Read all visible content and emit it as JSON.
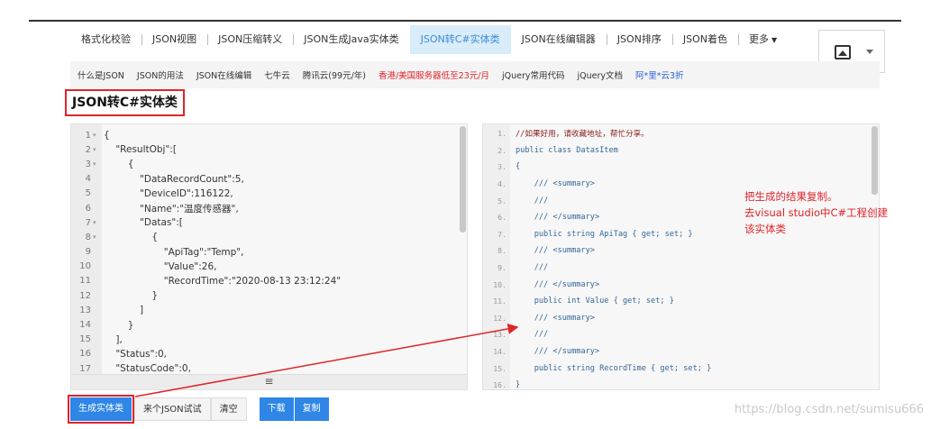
{
  "tabs": [
    {
      "label": "格式化校验"
    },
    {
      "label": "JSON视图"
    },
    {
      "label": "JSON压缩转义"
    },
    {
      "label": "JSON生成Java实体类"
    },
    {
      "label": "JSON转C#实体类",
      "active": true
    },
    {
      "label": "JSON在线编辑器"
    },
    {
      "label": "JSON排序"
    },
    {
      "label": "JSON着色"
    },
    {
      "label": "更多"
    }
  ],
  "links": [
    {
      "label": "什么是JSON",
      "color": "default"
    },
    {
      "label": "JSON的用法",
      "color": "default"
    },
    {
      "label": "JSON在线编辑",
      "color": "default"
    },
    {
      "label": "七牛云",
      "color": "default"
    },
    {
      "label": "腾讯云(99元/年)",
      "color": "default"
    },
    {
      "label": "香港/美国服务器低至23元/月",
      "color": "red"
    },
    {
      "label": "jQuery常用代码",
      "color": "default"
    },
    {
      "label": "jQuery文档",
      "color": "default"
    },
    {
      "label": "阿*里*云3折",
      "color": "blue"
    }
  ],
  "page_title": "JSON转C#实体类",
  "left_editor": {
    "lines": [
      {
        "n": "1",
        "fold": true,
        "code": "{"
      },
      {
        "n": "2",
        "fold": true,
        "code": "    \"ResultObj\":["
      },
      {
        "n": "3",
        "fold": true,
        "code": "        {"
      },
      {
        "n": "4",
        "fold": false,
        "code": "            \"DataRecordCount\":5,"
      },
      {
        "n": "5",
        "fold": false,
        "code": "            \"DeviceID\":116122,"
      },
      {
        "n": "6",
        "fold": false,
        "code": "            \"Name\":\"温度传感器\","
      },
      {
        "n": "7",
        "fold": true,
        "code": "            \"Datas\":["
      },
      {
        "n": "8",
        "fold": true,
        "code": "                {"
      },
      {
        "n": "9",
        "fold": false,
        "code": "                    \"ApiTag\":\"Temp\","
      },
      {
        "n": "10",
        "fold": false,
        "code": "                    \"Value\":26,"
      },
      {
        "n": "11",
        "fold": false,
        "code": "                    \"RecordTime\":\"2020-08-13 23:12:24\""
      },
      {
        "n": "12",
        "fold": false,
        "code": "                }"
      },
      {
        "n": "13",
        "fold": false,
        "code": "            ]"
      },
      {
        "n": "14",
        "fold": false,
        "code": "        }"
      },
      {
        "n": "15",
        "fold": false,
        "code": "    ],"
      },
      {
        "n": "16",
        "fold": false,
        "code": "    \"Status\":0,"
      },
      {
        "n": "17",
        "fold": false,
        "code": "    \"StatusCode\":0,"
      }
    ],
    "splitter_glyph": "≡"
  },
  "right_editor": {
    "lines": [
      {
        "n": "1.",
        "code": "//如果好用，请收藏地址，帮忙分享。",
        "comment": true
      },
      {
        "n": "2.",
        "code": "public class DatasItem"
      },
      {
        "n": "3.",
        "code": "{"
      },
      {
        "n": "4.",
        "code": "    /// <summary>"
      },
      {
        "n": "5.",
        "code": "    ///"
      },
      {
        "n": "6.",
        "code": "    /// </summary>"
      },
      {
        "n": "7.",
        "code": "    public string ApiTag { get; set; }"
      },
      {
        "n": "8.",
        "code": "    /// <summary>"
      },
      {
        "n": "9.",
        "code": "    ///"
      },
      {
        "n": "10.",
        "code": "    /// </summary>"
      },
      {
        "n": "11.",
        "code": "    public int Value { get; set; }"
      },
      {
        "n": "12.",
        "code": "    /// <summary>"
      },
      {
        "n": "13.",
        "code": "    ///"
      },
      {
        "n": "14.",
        "code": "    /// </summary>"
      },
      {
        "n": "15.",
        "code": "    public string RecordTime { get; set; }"
      },
      {
        "n": "16.",
        "code": "}"
      }
    ]
  },
  "annotation": [
    "把生成的结果复制。",
    "去visual studio中C#工程创建",
    "该实体类"
  ],
  "buttons": {
    "generate": "生成实体类",
    "sample": "来个JSON试试",
    "clear": "清空",
    "download": "下载",
    "copy": "复制"
  },
  "watermark": "https://blog.csdn.net/sumisu666",
  "colors": {
    "accent": "#2f86e6",
    "annotation": "#e0242a",
    "active_tab_bg": "#d9ecfa"
  }
}
